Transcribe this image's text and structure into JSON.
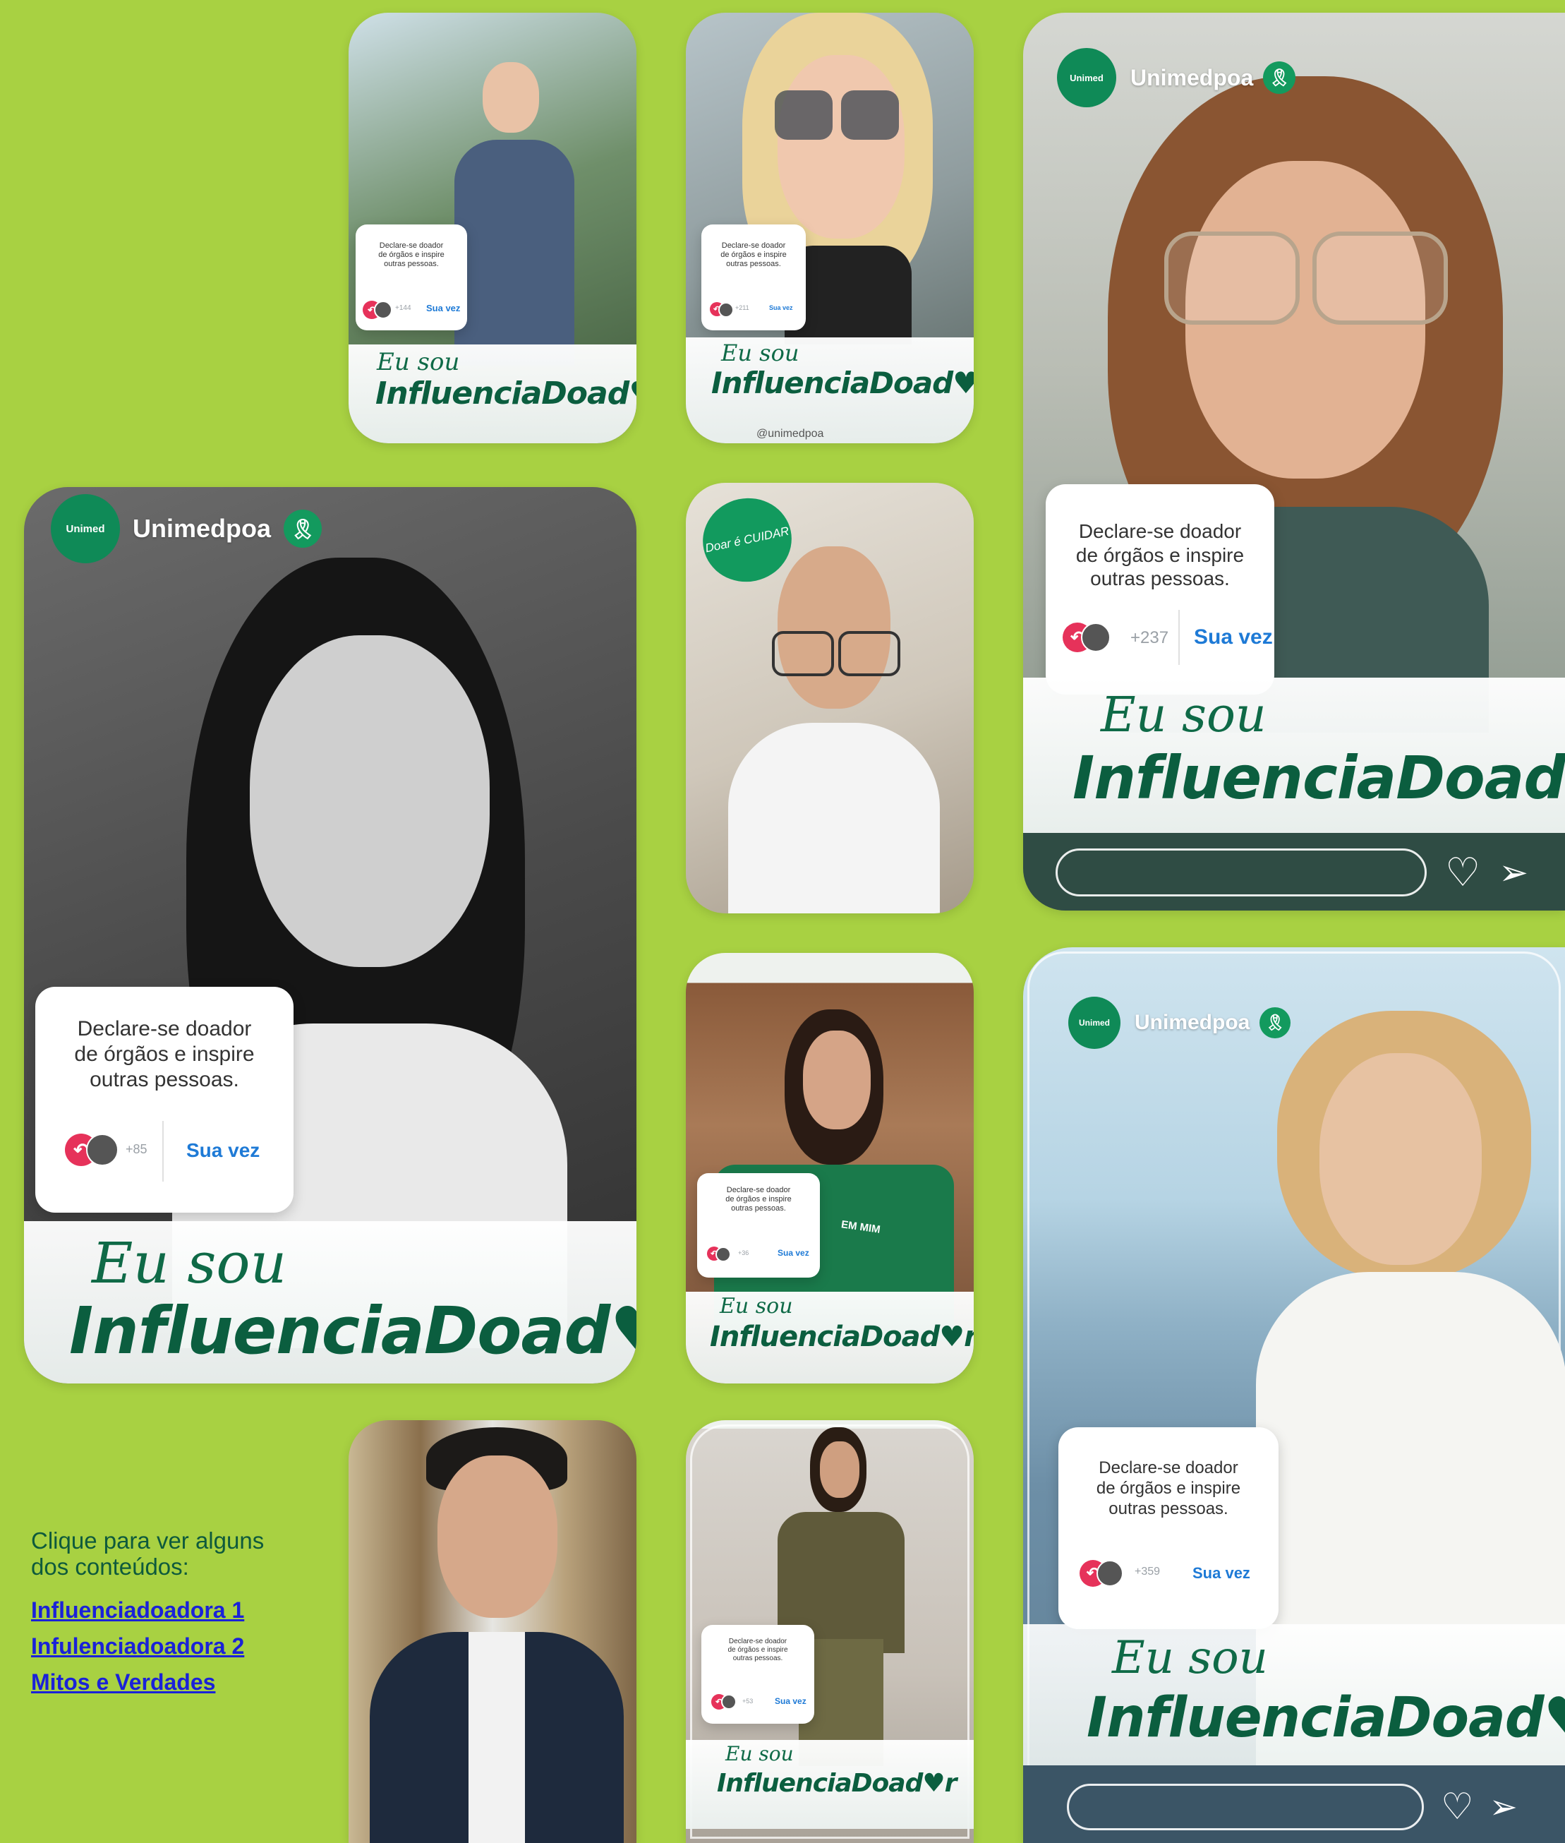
{
  "campaign": {
    "eu_sou": "Eu sou",
    "brand": "InfluenciaDoad",
    "brand_end": "r"
  },
  "profile": {
    "name": "Unimedpoa",
    "logo_text": "Unimed",
    "ribbon": "🎗"
  },
  "sticker": {
    "line1": "Declare-se doador",
    "line2": "de órgãos e inspire",
    "line3": "outras pessoas.",
    "action": "Sua vez"
  },
  "cards": [
    {
      "id": "runner",
      "count": "+144"
    },
    {
      "id": "sunglasses",
      "count": "+211",
      "handle": "@unimedpoa"
    },
    {
      "id": "glasses-woman",
      "count": "+237"
    },
    {
      "id": "bw-woman",
      "count": "+85"
    },
    {
      "id": "doctor",
      "note": "Doar é CUIDAR"
    },
    {
      "id": "tshirt-woman",
      "count": "+36",
      "shirt_text": "EM MIM"
    },
    {
      "id": "blonde-woman",
      "count": "+359"
    },
    {
      "id": "man-blazer"
    },
    {
      "id": "mirror-woman",
      "count": "+53"
    }
  ],
  "sidebar": {
    "prompt": "Clique para ver alguns dos conteúdos:",
    "links": [
      "Influenciadoadora 1",
      "Infulenciadoadora 2",
      "Mitos e Verdades"
    ]
  },
  "colors": {
    "background": "#a8d142",
    "brand_green": "#0b5e3f",
    "link_blue": "#1a22d8",
    "sticker_action": "#1e7ad6"
  }
}
